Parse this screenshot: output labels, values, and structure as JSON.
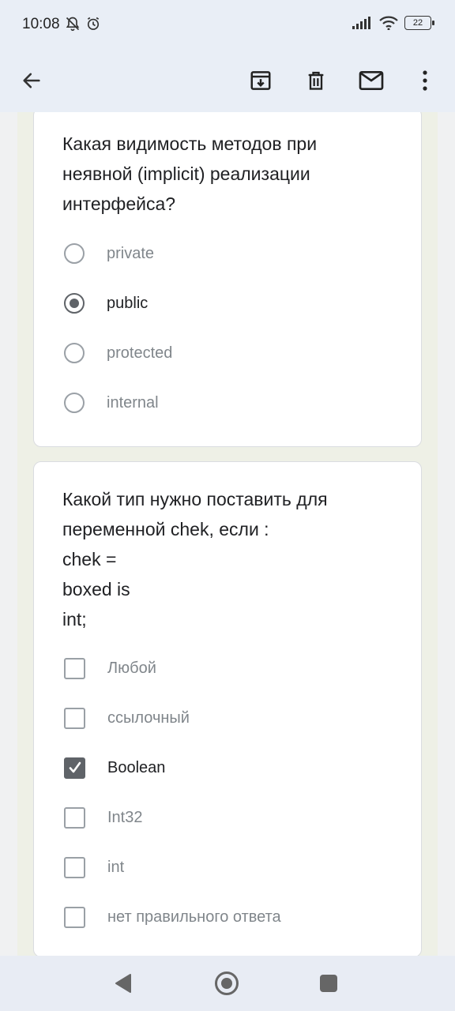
{
  "status": {
    "time": "10:08",
    "battery": "22"
  },
  "appbar": {
    "back_icon": "arrow-left-icon",
    "actions": [
      "archive-icon",
      "delete-icon",
      "mail-icon",
      "more-vert-icon"
    ]
  },
  "questions": [
    {
      "text": "Какая видимость методов при\nнеявной (implicit) реализации\nинтерфейса?",
      "type": "radio",
      "options": [
        {
          "label": "private",
          "selected": false
        },
        {
          "label": "public",
          "selected": true
        },
        {
          "label": "protected",
          "selected": false
        },
        {
          "label": "internal",
          "selected": false
        }
      ]
    },
    {
      "text": "Какой тип нужно поставить для\nпеременной  chek, если :\nchek =\nboxed is\nint;",
      "type": "checkbox",
      "options": [
        {
          "label": "Любой",
          "selected": false
        },
        {
          "label": "ссылочный",
          "selected": false
        },
        {
          "label": "Boolean",
          "selected": true
        },
        {
          "label": "Int32",
          "selected": false
        },
        {
          "label": "int",
          "selected": false
        },
        {
          "label": "нет правильного ответа",
          "selected": false
        }
      ]
    }
  ],
  "colors": {
    "selected": "#5f6368",
    "unselected": "#9aa0a6",
    "form_bg": "#eef0e6"
  }
}
